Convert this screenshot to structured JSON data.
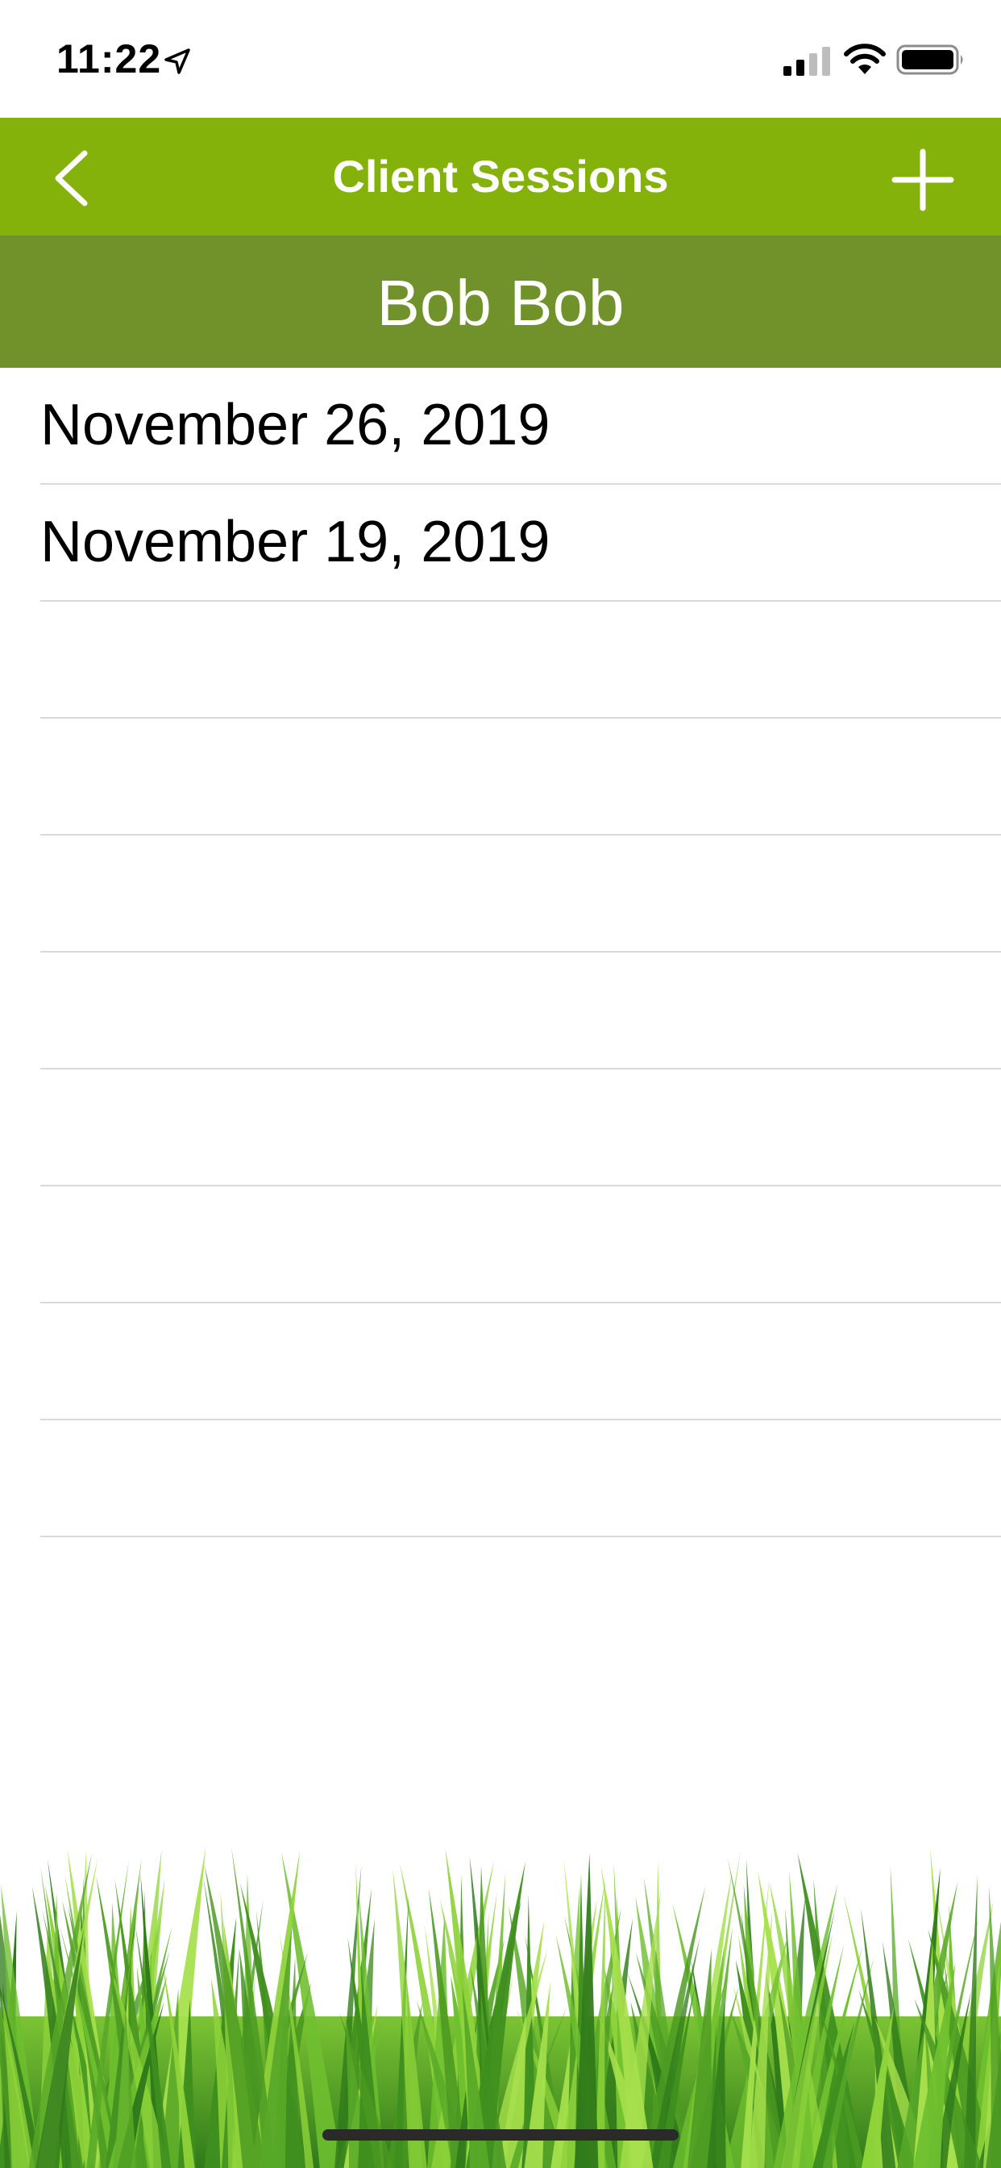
{
  "status_bar": {
    "time": "11:22",
    "icons": [
      "location-arrow-icon",
      "cellular-signal-icon",
      "wifi-icon",
      "battery-icon"
    ]
  },
  "nav": {
    "title": "Client Sessions",
    "back_icon": "chevron-left-icon",
    "add_icon": "plus-icon"
  },
  "client": {
    "name": "Bob Bob"
  },
  "sessions": [
    {
      "label": "November 26, 2019"
    },
    {
      "label": "November 19, 2019"
    },
    {
      "label": ""
    },
    {
      "label": ""
    },
    {
      "label": ""
    },
    {
      "label": ""
    },
    {
      "label": ""
    },
    {
      "label": ""
    },
    {
      "label": ""
    },
    {
      "label": ""
    }
  ],
  "colors": {
    "nav_bar": "#84b20b",
    "client_header": "#71922a",
    "separator": "#d9d9d9",
    "grass_light": "#8ed33a",
    "grass_dark": "#2f7a1a"
  }
}
